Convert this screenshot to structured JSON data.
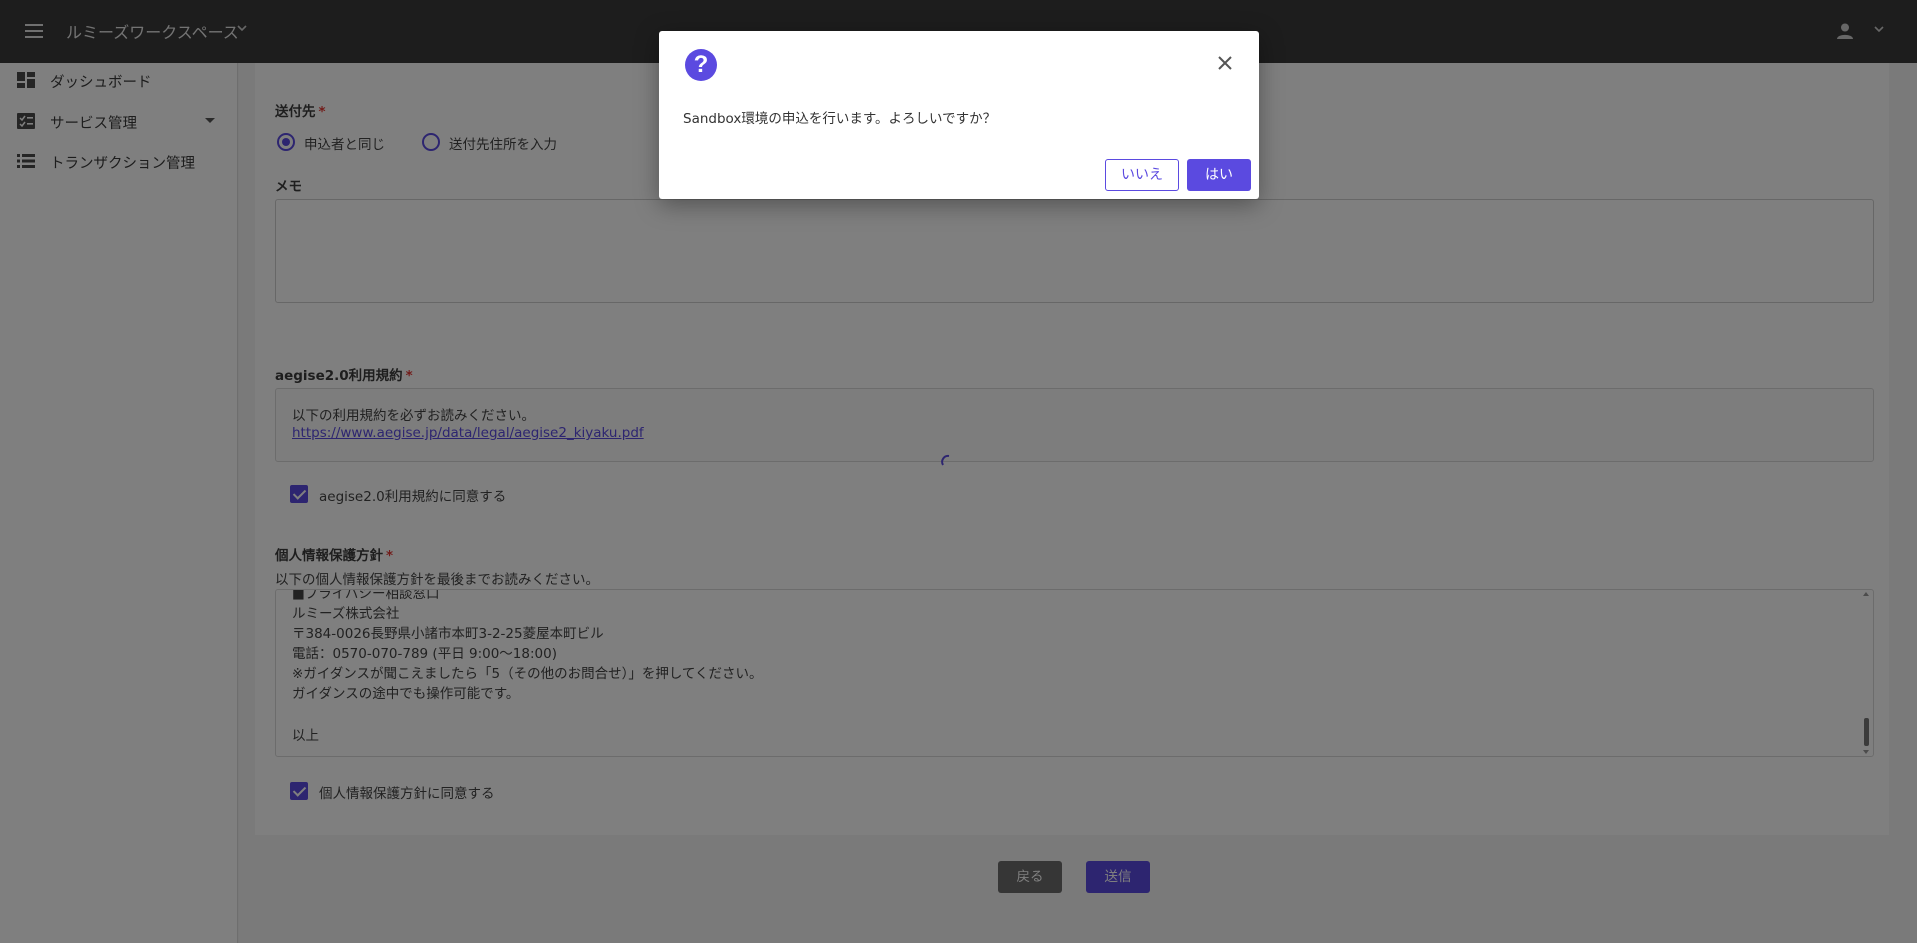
{
  "header": {
    "workspace_name": "ルミーズワークスペース"
  },
  "sidebar": {
    "items": [
      {
        "label": "ダッシュボード",
        "icon": "dashboard-icon"
      },
      {
        "label": "サービス管理",
        "icon": "service-list-icon",
        "expandable": true
      },
      {
        "label": "トランザクション管理",
        "icon": "transaction-list-icon"
      }
    ]
  },
  "form": {
    "shipping": {
      "label": "送付先",
      "required_mark": "*",
      "options": [
        {
          "label": "申込者と同じ",
          "selected": true
        },
        {
          "label": "送付先住所を入力",
          "selected": false
        }
      ]
    },
    "memo": {
      "label": "メモ",
      "value": ""
    },
    "terms": {
      "label": "aegise2.0利用規約",
      "required_mark": "*",
      "notice": "以下の利用規約を必ずお読みください。",
      "link": "https://www.aegise.jp/data/legal/aegise2_kiyaku.pdf",
      "agree_label": "aegise2.0利用規約に同意する",
      "agreed": true
    },
    "privacy": {
      "label": "個人情報保護方針",
      "required_mark": "*",
      "notice": "以下の個人情報保護方針を最後までお読みください。",
      "lines": [
        "■プライバシー相談窓口",
        "ルミーズ株式会社",
        "〒384-0026長野県小諸市本町3-2-25菱屋本町ビル",
        "電話：0570-070-789 (平日 9:00～18:00)",
        "※ガイダンスが聞こえましたら「5（その他のお問合せ）」を押してください。",
        "ガイダンスの途中でも操作可能です。",
        "",
        "以上"
      ],
      "agree_label": "個人情報保護方針に同意する",
      "agreed": true
    },
    "back_label": "戻る",
    "submit_label": "送信"
  },
  "dialog": {
    "message": "Sandbox環境の申込を行います。よろしいですか？",
    "no_label": "いいえ",
    "yes_label": "はい"
  },
  "colors": {
    "accent": "#5b4ae0",
    "header_bg": "#3a3a3a",
    "required": "#e53935"
  }
}
